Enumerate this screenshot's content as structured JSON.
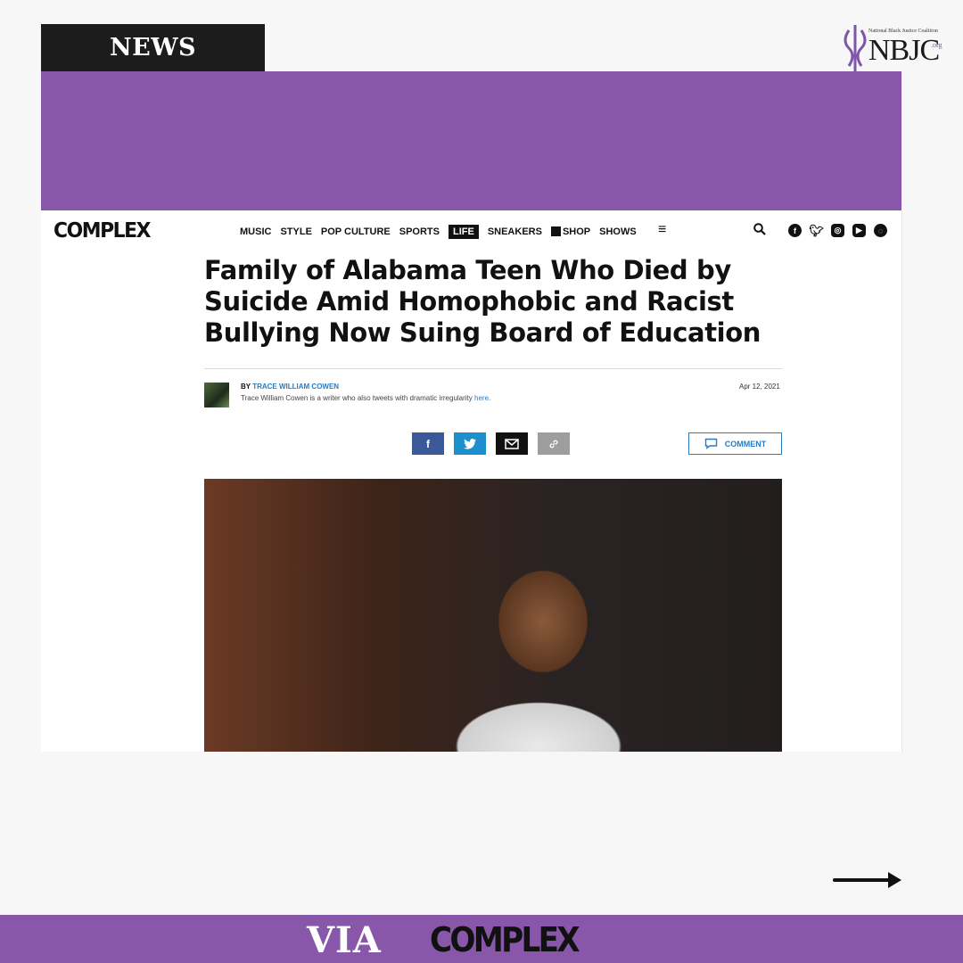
{
  "tag": {
    "label": "NEWS"
  },
  "logo": {
    "mark": "NBJC",
    "org": ".org",
    "tagline": "National Black Justice Coalition"
  },
  "site": {
    "brand": "COMPLEX",
    "nav": [
      "MUSIC",
      "STYLE",
      "POP CULTURE",
      "SPORTS",
      "LIFE",
      "SNEAKERS",
      "SHOP",
      "SHOWS"
    ],
    "menu_icon": "≡",
    "icons": {
      "search": "search-icon",
      "social": [
        "facebook-icon",
        "twitter-icon",
        "instagram-icon",
        "youtube-icon",
        "snapchat-icon"
      ]
    }
  },
  "article": {
    "headline": "Family of Alabama Teen Who Died by Suicide Amid Homophobic and Racist Bullying Now Suing Board of Education",
    "by_prefix": "BY",
    "author": "TRACE WILLIAM COWEN",
    "bio": "Trace William Cowen is a writer who also tweets with dramatic irregularity",
    "bio_link": "here",
    "bio_end": ".",
    "date": "Apr 12, 2021",
    "comment_label": "COMMENT"
  },
  "footer": {
    "via": "VIA",
    "brand": "COMPLEX"
  },
  "colors": {
    "purple": "#8957a9",
    "link": "#2a7ac0",
    "dark": "#1c1c1c"
  }
}
